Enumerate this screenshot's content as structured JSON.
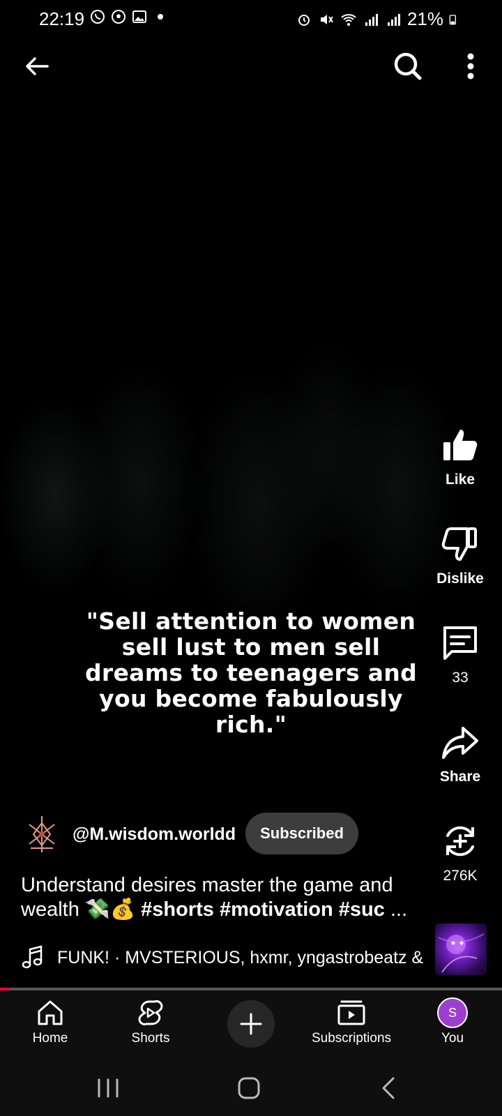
{
  "status_bar": {
    "time": "22:19",
    "battery": "21%",
    "left_icons": [
      "whatsapp-icon",
      "soccer-ball-icon",
      "image-icon",
      "dot-icon"
    ],
    "right_icons": [
      "alarm-icon",
      "mute-icon",
      "wifi-icon",
      "signal-icon",
      "signal-icon",
      "battery-icon"
    ]
  },
  "top_bar": {
    "back_icon": "arrow-left-icon",
    "search_icon": "search-icon",
    "more_icon": "more-vertical-icon"
  },
  "video": {
    "quote": "\"Sell attention to women sell lust to men sell dreams to teenagers and you become fabulously rich.\""
  },
  "actions": {
    "like_label": "Like",
    "dislike_label": "Dislike",
    "comments_count": "33",
    "share_label": "Share",
    "remix_count": "276K"
  },
  "channel": {
    "handle": "@M.wisdom.worldd",
    "subscribe_label": "Subscribed"
  },
  "description": {
    "text": "Understand desires master the game and wealth 💸💰 ",
    "tags": "#shorts #motivation #suc",
    "ellipsis": " ..."
  },
  "music": {
    "text": "FUNK! · MVSTERIOUS, hxmr, yngastrobeatz &"
  },
  "progress": {
    "fraction": 0.02
  },
  "colors": {
    "accent_red": "#ff0033",
    "avatar_purple": "#9c3fd1",
    "subscribed_bg": "#3d3d3d",
    "nav_bg": "#0f0f0f"
  },
  "bottom_nav": {
    "home": "Home",
    "shorts": "Shorts",
    "subscriptions": "Subscriptions",
    "you": "You",
    "avatar_letter": "S"
  }
}
